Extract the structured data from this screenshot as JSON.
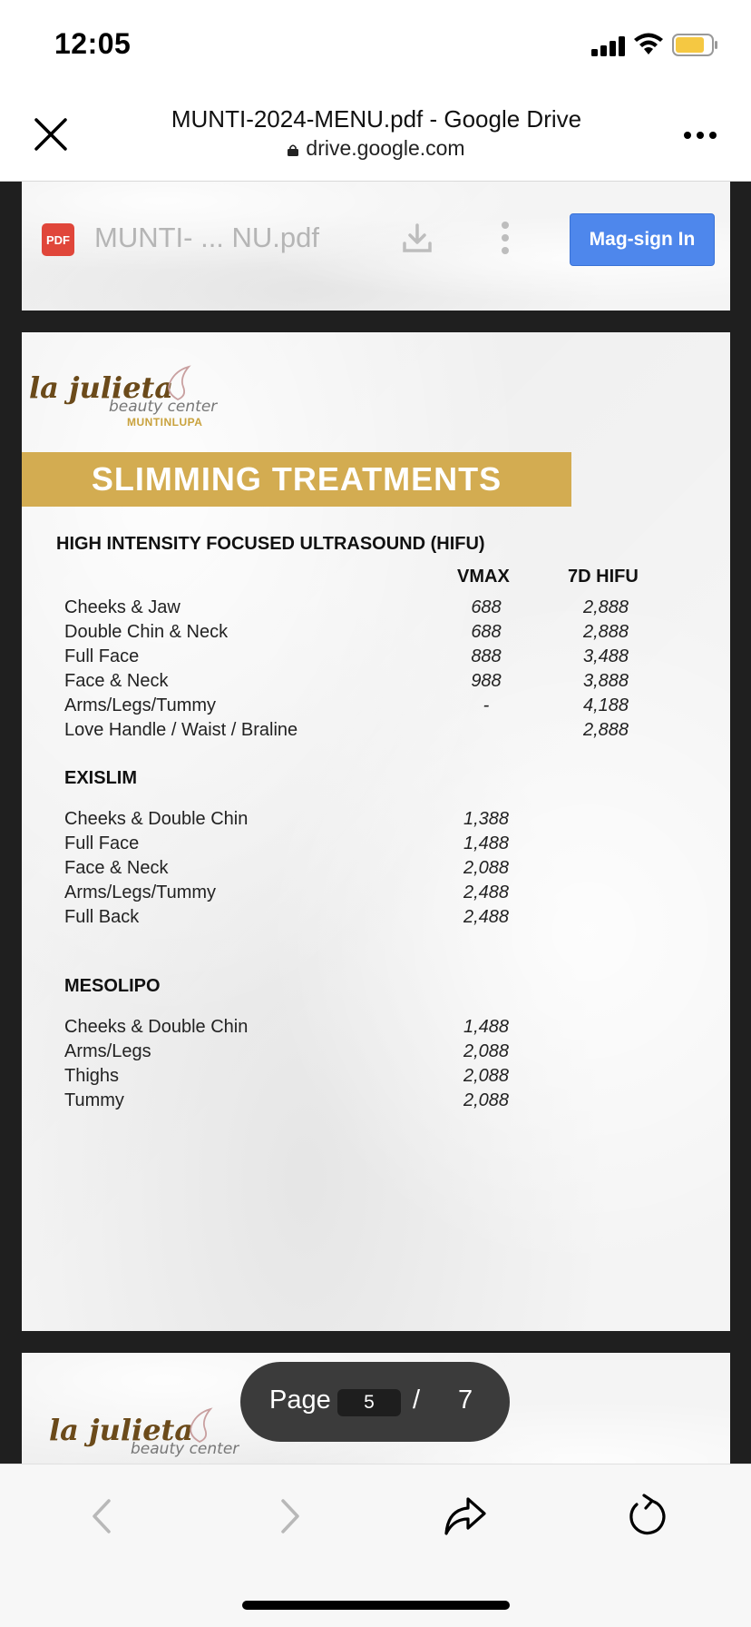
{
  "status_bar": {
    "time": "12:05"
  },
  "browser": {
    "title": "MUNTI-2024-MENU.pdf - Google Drive",
    "domain": "drive.google.com"
  },
  "drive_bar": {
    "pdf_badge": "PDF",
    "file_name": "MUNTI- ... NU.pdf",
    "signin_label": "Mag-sign In"
  },
  "menu": {
    "logo": {
      "script": "la julieta",
      "sub": "beauty center",
      "location": "MUNTINLUPA"
    },
    "banner_title": "SLIMMING TREATMENTS",
    "hifu": {
      "title": "HIGH INTENSITY FOCUSED ULTRASOUND (HIFU)",
      "col_vmax": "VMAX",
      "col_7d": "7D HIFU",
      "rows": [
        {
          "name": "Cheeks & Jaw",
          "vmax": "688",
          "hifu7d": "2,888"
        },
        {
          "name": "Double Chin & Neck",
          "vmax": "688",
          "hifu7d": "2,888"
        },
        {
          "name": "Full Face",
          "vmax": "888",
          "hifu7d": "3,488"
        },
        {
          "name": "Face & Neck",
          "vmax": "988",
          "hifu7d": "3,888"
        },
        {
          "name": "Arms/Legs/Tummy",
          "vmax": "-",
          "hifu7d": "4,188"
        },
        {
          "name": "Love Handle / Waist / Braline",
          "vmax": "",
          "hifu7d": "2,888"
        }
      ]
    },
    "exislim": {
      "title": "EXISLIM",
      "rows": [
        {
          "name": "Cheeks & Double Chin",
          "price": "1,388"
        },
        {
          "name": "Full Face",
          "price": "1,488"
        },
        {
          "name": "Face & Neck",
          "price": "2,088"
        },
        {
          "name": "Arms/Legs/Tummy",
          "price": "2,488"
        },
        {
          "name": "Full Back",
          "price": "2,488"
        }
      ]
    },
    "mesolipo": {
      "title": "MESOLIPO",
      "rows": [
        {
          "name": "Cheeks & Double Chin",
          "price": "1,488"
        },
        {
          "name": "Arms/Legs",
          "price": "2,088"
        },
        {
          "name": "Thighs",
          "price": "2,088"
        },
        {
          "name": "Tummy",
          "price": "2,088"
        }
      ]
    },
    "next_logo": {
      "script": "la julieta",
      "sub": "beauty center"
    }
  },
  "pager": {
    "label": "Page",
    "current": "5",
    "separator": "/",
    "total": "7"
  },
  "colors": {
    "banner": "#d3ac51",
    "signin": "#4e87ec",
    "pdf_icon": "#e0463a",
    "logo_gold": "#c9a23d"
  },
  "toolbar_icons": [
    "back-icon",
    "forward-icon",
    "share-icon",
    "reload-icon"
  ]
}
